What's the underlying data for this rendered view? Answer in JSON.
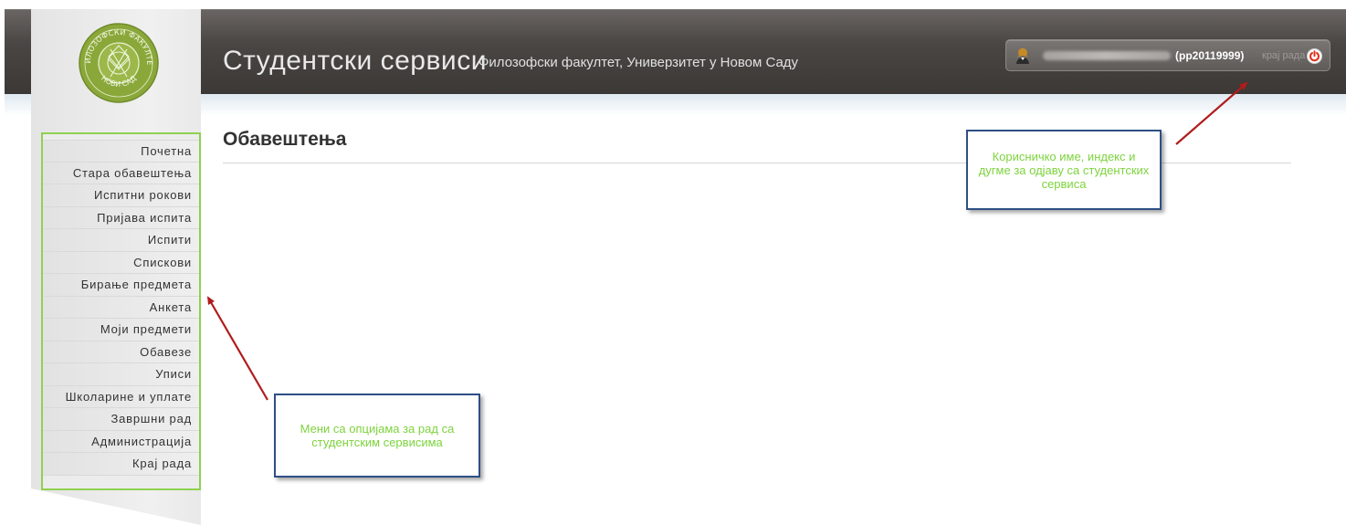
{
  "header": {
    "title": "Студентски сервиси",
    "subtitle": "Филозофски факултет, Универзитет у Новом Саду"
  },
  "user": {
    "index": "(pp20119999)",
    "logout_text": "крај рада",
    "icons": {
      "user": "user-icon",
      "logout": "power-icon"
    }
  },
  "logo": {
    "icon": "university-seal-icon",
    "text_top": "ФИЛОЗОФСКИ ФАКУЛТЕТ",
    "text_bottom": "НОВИ САД"
  },
  "sidebar": {
    "items": [
      {
        "label": "Почетна"
      },
      {
        "label": "Стара обавештења"
      },
      {
        "label": "Испитни рокови"
      },
      {
        "label": "Пријава испита"
      },
      {
        "label": "Испити"
      },
      {
        "label": "Спискови"
      },
      {
        "label": "Бирање предмета"
      },
      {
        "label": "Анкета"
      },
      {
        "label": "Моји предмети"
      },
      {
        "label": "Обавезе"
      },
      {
        "label": "Уписи"
      },
      {
        "label": "Школарине и уплате"
      },
      {
        "label": "Завршни рад"
      },
      {
        "label": "Администрација"
      },
      {
        "label": "Крај рада"
      }
    ]
  },
  "main": {
    "title": "Обавештења"
  },
  "annotations": {
    "top_right": "Корисничко име, индекс и дугме за одјаву са студентских сервиса",
    "menu": "Мени са опцијама за рад са студентским сервисима"
  },
  "colors": {
    "header_bg": "#4a4644",
    "menu_border": "#8fd14f",
    "callout_border": "#2f4f85",
    "callout_text": "#7dd33d",
    "arrow": "#b01c1c",
    "logo_green": "#8aa83a"
  }
}
